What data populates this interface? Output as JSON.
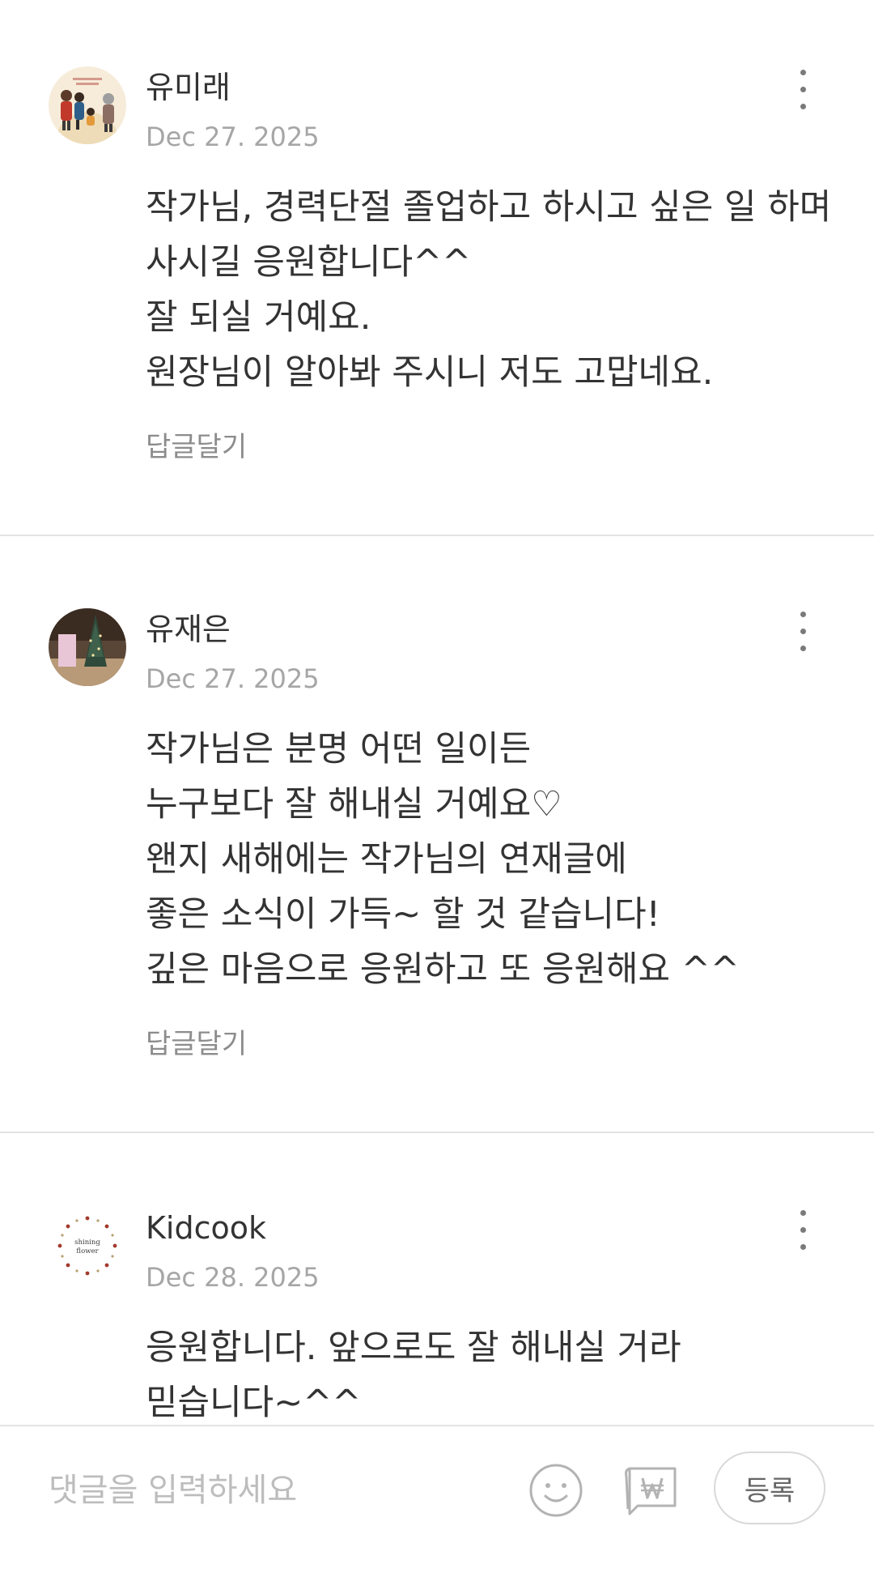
{
  "comments": [
    {
      "author": "유미래",
      "date": "Dec 27. 2025",
      "lines": [
        "작가님, 경력단절 졸업하고 하시고 싶은 일 하며",
        "사시길 응원합니다^^",
        "잘 되실 거예요.",
        "원장님이 알아봐 주시니 저도 고맙네요."
      ],
      "reply_label": "답글달기"
    },
    {
      "author": "유재은",
      "date": "Dec 27. 2025",
      "lines": [
        "작가님은 분명 어떤 일이든",
        "누구보다 잘 해내실 거예요♡",
        "왠지 새해에는 작가님의 연재글에",
        "좋은 소식이 가득~ 할 것 같습니다!",
        "깊은 마음으로 응원하고 또 응원해요 ^^"
      ],
      "reply_label": "답글달기"
    },
    {
      "author": "Kidcook",
      "date": "Dec 28. 2025",
      "avatar_text": [
        "shining",
        "flower"
      ],
      "lines": [
        "응원합니다. 앞으로도 잘 해내실 거라",
        "믿습니다~^^"
      ]
    }
  ],
  "composer": {
    "placeholder": "댓글을 입력하세요",
    "submit_label": "등록",
    "icons": [
      "smile-icon",
      "won-coin-icon",
      "more-vertical-icon"
    ]
  },
  "colors": {
    "text": "#333333",
    "muted": "#a6a6a6",
    "divider": "#e3e3e3"
  }
}
